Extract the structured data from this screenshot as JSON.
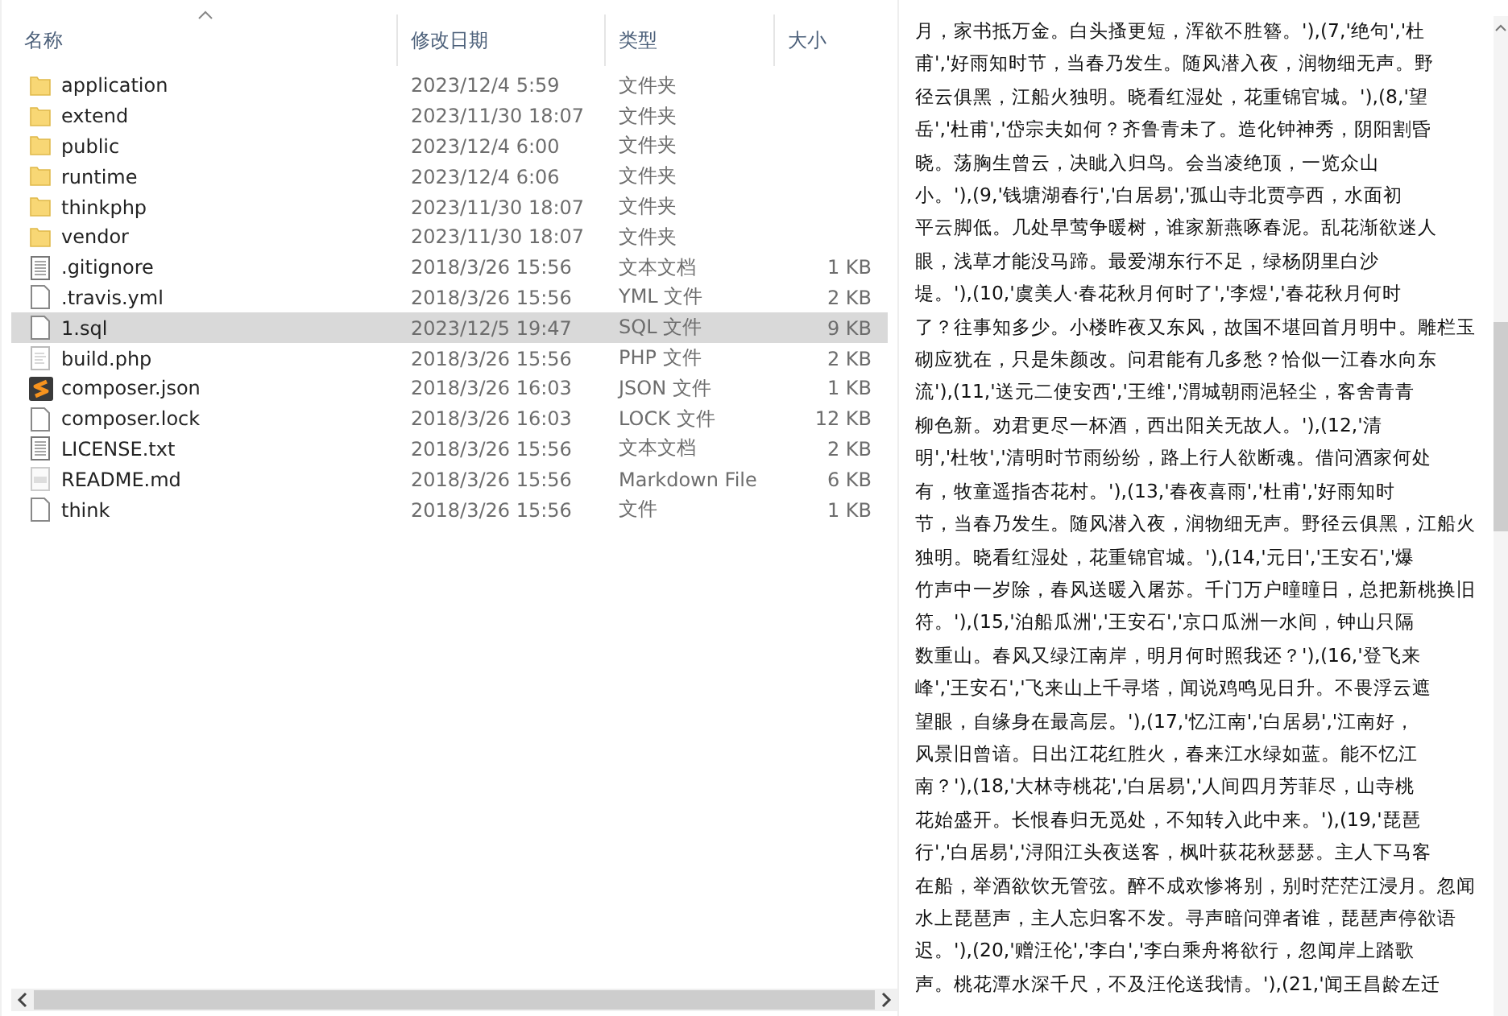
{
  "file_list": {
    "columns": [
      {
        "label": "名称",
        "sorted": true
      },
      {
        "label": "修改日期",
        "sorted": false
      },
      {
        "label": "类型",
        "sorted": false
      },
      {
        "label": "大小",
        "sorted": false
      }
    ],
    "rows": [
      {
        "kind": "folder",
        "name": "application",
        "date": "2023/12/4 5:59",
        "type": "文件夹",
        "selected": false
      },
      {
        "kind": "folder",
        "name": "extend",
        "date": "2023/11/30 18:07",
        "type": "文件夹",
        "selected": false
      },
      {
        "kind": "folder",
        "name": "public",
        "date": "2023/12/4 6:00",
        "type": "文件夹",
        "selected": false
      },
      {
        "kind": "folder",
        "name": "runtime",
        "date": "2023/12/4 6:06",
        "type": "文件夹",
        "selected": false
      },
      {
        "kind": "folder",
        "name": "thinkphp",
        "date": "2023/11/30 18:07",
        "type": "文件夹",
        "selected": false
      },
      {
        "kind": "folder",
        "name": "vendor",
        "date": "2023/11/30 18:07",
        "type": "文件夹",
        "selected": false
      },
      {
        "kind": "text",
        "name": ".gitignore",
        "date": "2018/3/26 15:56",
        "type": "文本文档",
        "size": "1 KB",
        "selected": false
      },
      {
        "kind": "blank",
        "name": ".travis.yml",
        "date": "2018/3/26 15:56",
        "type": "YML 文件",
        "size": "2 KB",
        "selected": false
      },
      {
        "kind": "blank",
        "name": "1.sql",
        "date": "2023/12/5 19:47",
        "type": "SQL 文件",
        "size": "9 KB",
        "selected": true
      },
      {
        "kind": "script",
        "name": "build.php",
        "date": "2018/3/26 15:56",
        "type": "PHP 文件",
        "size": "2 KB",
        "selected": false
      },
      {
        "kind": "app",
        "name": "composer.json",
        "date": "2018/3/26 16:03",
        "type": "JSON 文件",
        "size": "1 KB",
        "selected": false
      },
      {
        "kind": "blank",
        "name": "composer.lock",
        "date": "2018/3/26 16:03",
        "type": "LOCK 文件",
        "size": "12 KB",
        "selected": false
      },
      {
        "kind": "text",
        "name": "LICENSE.txt",
        "date": "2018/3/26 15:56",
        "type": "文本文档",
        "size": "2 KB",
        "selected": false
      },
      {
        "kind": "markdown",
        "name": "README.md",
        "date": "2018/3/26 15:56",
        "type": "Markdown File",
        "size": "6 KB",
        "selected": false
      },
      {
        "kind": "blank",
        "name": "think",
        "date": "2018/3/26 15:56",
        "type": "文件",
        "size": "1 KB",
        "selected": false
      }
    ]
  },
  "preview": {
    "lines": [
      "月，家书抵万金。白头搔更短，浑欲不胜簪。'),(7,'绝句','杜",
      "甫','好雨知时节，当春乃发生。随风潜入夜，润物细无声。野",
      "径云俱黑，江船火独明。晓看红湿处，花重锦官城。'),(8,'望",
      "岳','杜甫','岱宗夫如何？齐鲁青未了。造化钟神秀，阴阳割昏",
      "晓。荡胸生曾云，决眦入归鸟。会当凌绝顶，一览众山",
      "小。'),(9,'钱塘湖春行','白居易','孤山寺北贾亭西，水面初",
      "平云脚低。几处早莺争暖树，谁家新燕啄春泥。乱花渐欲迷人",
      "眼，浅草才能没马蹄。最爱湖东行不足，绿杨阴里白沙",
      "堤。'),(10,'虞美人·春花秋月何时了','李煜','春花秋月何时",
      "了？往事知多少。小楼昨夜又东风，故国不堪回首月明中。雕栏玉",
      "砌应犹在，只是朱颜改。问君能有几多愁？恰似一江春水向东",
      "流'),(11,'送元二使安西','王维','渭城朝雨浥轻尘，客舍青青",
      "柳色新。劝君更尽一杯酒，西出阳关无故人。'),(12,'清",
      "明','杜牧','清明时节雨纷纷，路上行人欲断魂。借问酒家何处",
      "有，牧童遥指杏花村。'),(13,'春夜喜雨','杜甫','好雨知时",
      "节，当春乃发生。随风潜入夜，润物细无声。野径云俱黑，江船火",
      "独明。晓看红湿处，花重锦官城。'),(14,'元日','王安石','爆",
      "竹声中一岁除，春风送暖入屠苏。千门万户曈曈日，总把新桃换旧",
      "符。'),(15,'泊船瓜洲','王安石','京口瓜洲一水间，钟山只隔",
      "数重山。春风又绿江南岸，明月何时照我还？'),(16,'登飞来",
      "峰','王安石','飞来山上千寻塔，闻说鸡鸣见日升。不畏浮云遮",
      "望眼，自缘身在最高层。'),(17,'忆江南','白居易','江南好，",
      "风景旧曾谙。日出江花红胜火，春来江水绿如蓝。能不忆江",
      "南？'),(18,'大林寺桃花','白居易','人间四月芳菲尽，山寺桃",
      "花始盛开。长恨春归无觅处，不知转入此中来。'),(19,'琵琶",
      "行','白居易','浔阳江头夜送客，枫叶荻花秋瑟瑟。主人下马客",
      "在船，举酒欲饮无管弦。醉不成欢惨将别，别时茫茫江浸月。忽闻",
      "水上琵琶声，主人忘归客不发。寻声暗问弹者谁，琵琶声停欲语",
      "迟。'),(20,'赠汪伦','李白','李白乘舟将欲行，忽闻岸上踏歌",
      "声。桃花潭水深千尺，不及汪伦送我情。'),(21,'闻王昌龄左迁"
    ]
  }
}
